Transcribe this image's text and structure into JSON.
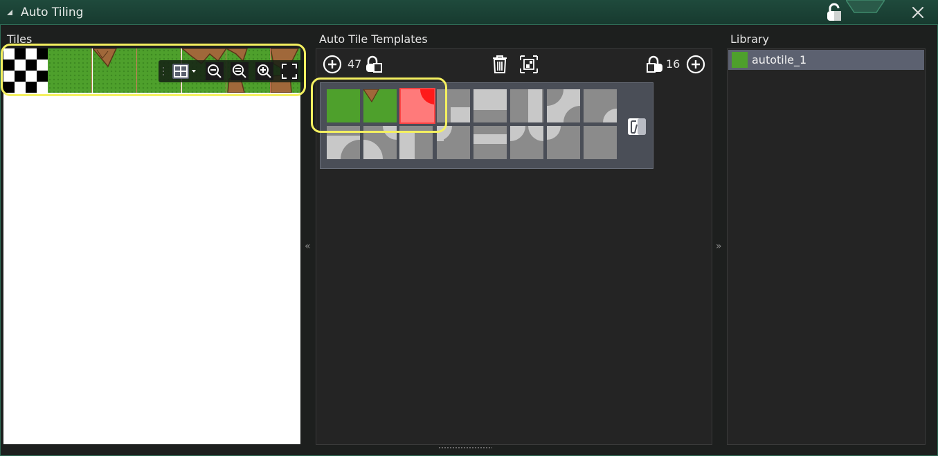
{
  "window": {
    "title": "Auto Tiling",
    "accent": "#2f6b55",
    "highlight_color": "#f4f060"
  },
  "tiles": {
    "label": "Tiles",
    "toolbar": {
      "icons": [
        "grid-icon",
        "zoom-out-icon",
        "zoom-reset-icon",
        "zoom-in-icon",
        "fit-screen-icon"
      ]
    }
  },
  "templates": {
    "label": "Auto Tile Templates",
    "count_left": "47",
    "count_right": "16"
  },
  "library": {
    "label": "Library",
    "items": [
      {
        "label": "autotile_1",
        "swatch": "#4ea02c"
      }
    ]
  },
  "splitters": {
    "left": "«",
    "right": "»"
  }
}
